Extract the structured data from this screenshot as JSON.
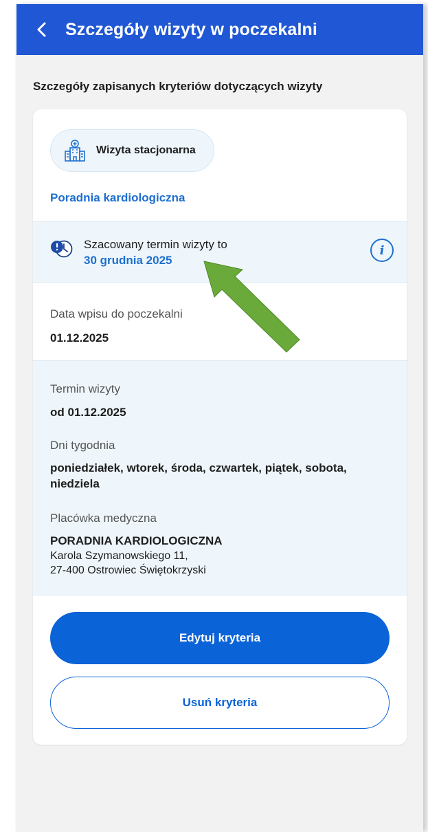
{
  "header": {
    "title": "Szczegóły wizyty w poczekalni",
    "back_icon": "chevron-left-icon",
    "background_color": "#2057d4"
  },
  "subtitle": "Szczegóły zapisanych kryteriów dotyczących wizyty",
  "card": {
    "visit_type": {
      "label": "Wizyta stacjonarna",
      "icon": "hospital-icon"
    },
    "clinic_name": "Poradnia kardiologiczna",
    "estimated": {
      "label": "Szacowany termin wizyty to",
      "date": "30 grudnia 2025",
      "icon": "clock-alert-icon",
      "info_icon": "info-icon",
      "info_glyph": "i"
    },
    "registration": {
      "label": "Data wpisu do poczekalni",
      "value": "01.12.2025"
    },
    "criteria": {
      "term_label": "Termin wizyty",
      "term_value": "od 01.12.2025",
      "days_label": "Dni tygodnia",
      "days_line1": "poniedziałek, wtorek, środa, czwartek, piątek, sobota,",
      "days_line2": "niedziela",
      "facility_label": "Placówka medyczna",
      "facility_name": "PORADNIA KARDIOLOGICZNA",
      "facility_address_line1": "Karola Szymanowskiego 11,",
      "facility_address_line2": "27-400 Ostrowiec Świętokrzyski"
    },
    "buttons": {
      "edit": "Edytuj kryteria",
      "delete": "Usuń kryteria"
    }
  },
  "colors": {
    "accent": "#0b63d8",
    "link": "#1e6fd0",
    "highlight_arrow": "#6aaa3a"
  }
}
